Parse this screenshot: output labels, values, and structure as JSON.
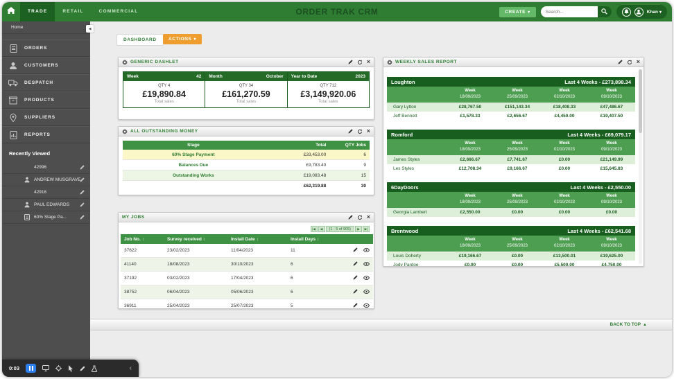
{
  "topbar": {
    "title": "ORDER TRAK CRM",
    "tabs": [
      "TRADE",
      "RETAIL",
      "COMMERCIAL"
    ],
    "create_label": "CREATE",
    "search_placeholder": "Search...",
    "user_name": "Khan"
  },
  "sidebar": {
    "home_label": "Home",
    "items": [
      "ORDERS",
      "CUSTOMERS",
      "DESPATCH",
      "PRODUCTS",
      "SUPPLIERS",
      "REPORTS"
    ],
    "recent_header": "Recently Viewed",
    "recent_items": [
      "42996",
      "ANDREW MUSGRAVE",
      "42916",
      "PAUL EDWARDS",
      "60% Stage Pa..."
    ]
  },
  "content": {
    "dashboard_label": "DASHBOARD",
    "actions_label": "ACTIONS",
    "back_to_top": "BACK TO TOP"
  },
  "generic_dashlet": {
    "title": "GENERIC DASHLET",
    "columns": [
      {
        "period": "Week",
        "period_value": "42",
        "qty_label": "QTY 4",
        "amount": "£19,890.84",
        "caption": "Total sales"
      },
      {
        "period": "Month",
        "period_value": "October",
        "qty_label": "QTY 34",
        "amount": "£161,270.59",
        "caption": "Total sales"
      },
      {
        "period": "Year to Date",
        "period_value": "2023",
        "qty_label": "QTY 712",
        "amount": "£3,149,920.06",
        "caption": "Total sales"
      }
    ]
  },
  "outstanding": {
    "title": "ALL OUTSTANDING MONEY",
    "col_stage": "Stage",
    "col_total": "Total",
    "col_qty": "QTY Jobs",
    "rows": [
      {
        "stage": "60% Stage Payment",
        "total": "£33,453.00",
        "qty": "6"
      },
      {
        "stage": "Balances Due",
        "total": "£9,783.40",
        "qty": "9"
      },
      {
        "stage": "Outstanding Works",
        "total": "£19,083.48",
        "qty": "15"
      }
    ],
    "grand_total": "£62,319.88",
    "grand_qty": "30"
  },
  "myjobs": {
    "title": "MY JOBS",
    "pagination": "(1 - 5 of 905)",
    "col_job": "Job No.",
    "col_survey": "Survey received",
    "col_install": "Install Date",
    "col_days": "Install Days",
    "rows": [
      {
        "job": "37622",
        "survey": "23/02/2023",
        "install": "11/04/2023",
        "days": "11"
      },
      {
        "job": "41140",
        "survey": "18/08/2023",
        "install": "30/10/2023",
        "days": "6"
      },
      {
        "job": "37192",
        "survey": "03/02/2023",
        "install": "17/04/2023",
        "days": "6"
      },
      {
        "job": "38752",
        "survey": "06/04/2023",
        "install": "05/06/2023",
        "days": "6"
      },
      {
        "job": "36911",
        "survey": "25/04/2023",
        "install": "25/07/2023",
        "days": "5"
      }
    ]
  },
  "weekly": {
    "title": "WEEKLY SALES REPORT",
    "week_label": "Week",
    "weeks": [
      "18/09/2023",
      "25/09/2023",
      "02/10/2023",
      "09/10/2023"
    ],
    "sections": [
      {
        "branch": "Loughton",
        "total": "Last 4 Weeks - £273,898.34",
        "rows": [
          {
            "name": "Gary Lytton",
            "values": [
              "£28,767.50",
              "£151,143.34",
              "£18,408.33",
              "£47,486.67"
            ]
          },
          {
            "name": "Jeff Bennett",
            "values": [
              "£1,578.33",
              "£2,656.67",
              "£4,450.00",
              "£19,407.50"
            ]
          }
        ]
      },
      {
        "branch": "Romford",
        "total": "Last 4 Weeks - £69,079.17",
        "rows": [
          {
            "name": "James Styles",
            "values": [
              "£2,666.67",
              "£7,741.67",
              "£0.00",
              "£21,149.99"
            ]
          },
          {
            "name": "Les Styles",
            "values": [
              "£12,708.34",
              "£9,166.67",
              "£0.00",
              "£15,645.83"
            ]
          }
        ]
      },
      {
        "branch": "6DayDoors",
        "total": "Last 4 Weeks - £2,550.00",
        "rows": [
          {
            "name": "Georgia Lambert",
            "values": [
              "£2,550.00",
              "£0.00",
              "£0.00",
              "£0.00"
            ]
          }
        ]
      },
      {
        "branch": "Brentwood",
        "total": "Last 4 Weeks - £62,541.68",
        "rows": [
          {
            "name": "Louis Doherty",
            "values": [
              "£19,166.67",
              "£0.00",
              "£13,500.01",
              "£19,625.00"
            ]
          },
          {
            "name": "Jody Pardoe",
            "values": [
              "£0.00",
              "£0.00",
              "£5,500.00",
              "£4,750.00"
            ]
          }
        ]
      }
    ]
  },
  "recorder": {
    "time": "0:03"
  },
  "colors": {
    "brand_green": "#2e7d32",
    "dark_green": "#1b5e20",
    "accent_orange": "#ee9d2e",
    "highlight_yellow": "#fbf7c8",
    "sidebar_gray": "#4e4e4e"
  }
}
